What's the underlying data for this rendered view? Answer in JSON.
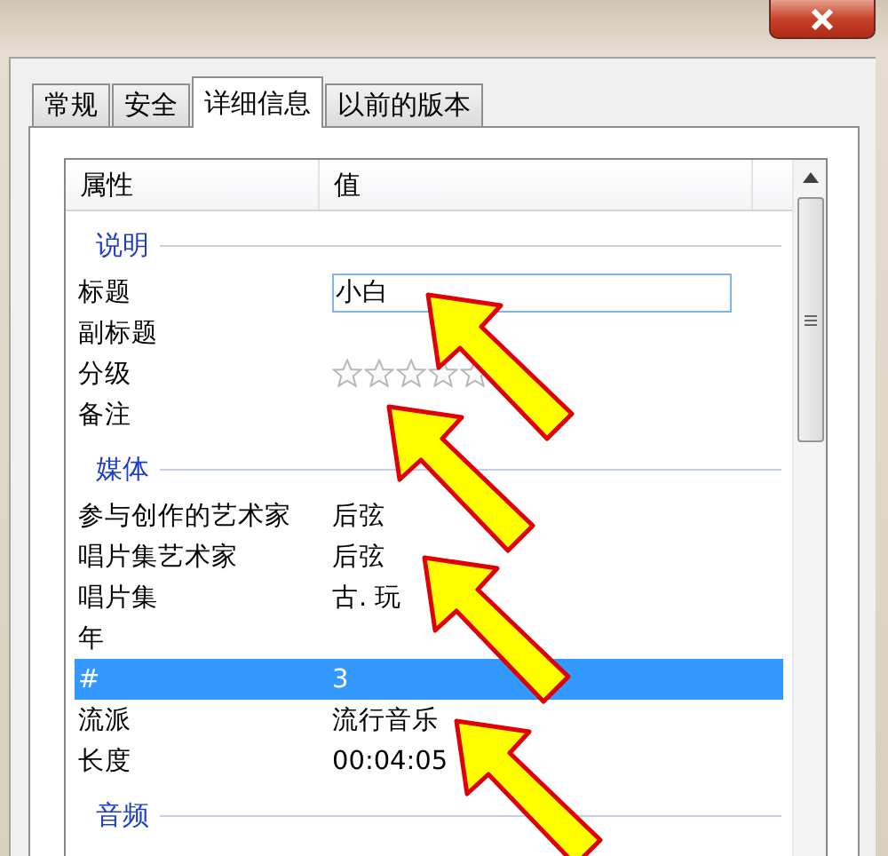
{
  "tabs": [
    {
      "label": "常规",
      "selected": false
    },
    {
      "label": "安全",
      "selected": false
    },
    {
      "label": "详细信息",
      "selected": true
    },
    {
      "label": "以前的版本",
      "selected": false
    }
  ],
  "list": {
    "columns": [
      "属性",
      "值"
    ],
    "rows": [
      {
        "kind": "group",
        "label": "说明"
      },
      {
        "kind": "field",
        "name": "标题",
        "value": "小白",
        "selected": false
      },
      {
        "kind": "text",
        "name": "副标题",
        "selected": false
      },
      {
        "kind": "rating",
        "name": "分级",
        "stars": 0,
        "selected": false
      },
      {
        "kind": "text",
        "name": "备注",
        "selected": false
      },
      {
        "kind": "group",
        "label": "媒体"
      },
      {
        "kind": "text",
        "name": "参与创作的艺术家",
        "value": "后弦",
        "selected": false
      },
      {
        "kind": "text",
        "name": "唱片集艺术家",
        "value": "后弦",
        "selected": false
      },
      {
        "kind": "text",
        "name": "唱片集",
        "value": "古. 玩",
        "selected": false
      },
      {
        "kind": "text",
        "name": "年",
        "selected": false
      },
      {
        "kind": "text",
        "name": "#",
        "value": "3",
        "selected": true
      },
      {
        "kind": "text",
        "name": "流派",
        "value": "流行音乐",
        "selected": false
      },
      {
        "kind": "text",
        "name": "长度",
        "value": "00:04:05",
        "selected": false
      },
      {
        "kind": "group",
        "label": "音频"
      }
    ]
  }
}
